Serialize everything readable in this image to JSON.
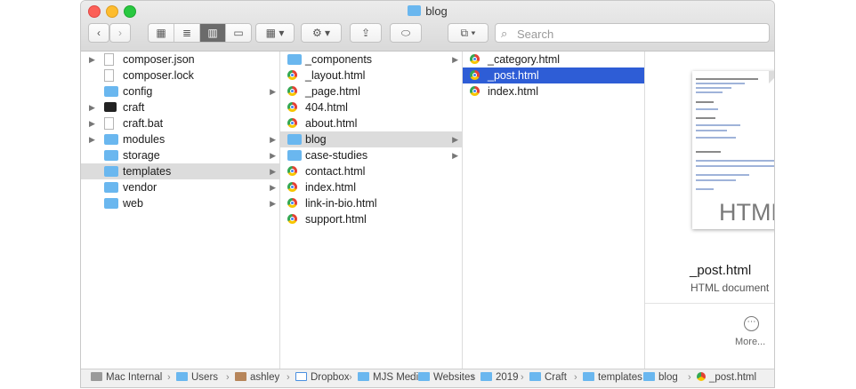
{
  "window": {
    "title": "blog"
  },
  "toolbar": {
    "back": "‹",
    "forward": "›",
    "view_icons": "▦",
    "view_list": "≣",
    "view_columns": "▥",
    "view_gallery": "▭",
    "group": "▦ ▾",
    "action": "⚙ ▾",
    "share": "⇪",
    "tag": "⬭",
    "dropbox": "⧉ ▾",
    "search_placeholder": "Search"
  },
  "columns": [
    {
      "items": [
        {
          "name": "composer.json",
          "kind": "doc",
          "disclosure": "▶"
        },
        {
          "name": "composer.lock",
          "kind": "doc",
          "disclosure": ""
        },
        {
          "name": "config",
          "kind": "folder",
          "arrow": "▶"
        },
        {
          "name": "craft",
          "kind": "exec",
          "disclosure": "▶"
        },
        {
          "name": "craft.bat",
          "kind": "doc",
          "disclosure": "▶"
        },
        {
          "name": "modules",
          "kind": "folder",
          "arrow": "▶",
          "disclosure": "▶"
        },
        {
          "name": "storage",
          "kind": "folder",
          "arrow": "▶"
        },
        {
          "name": "templates",
          "kind": "folder",
          "arrow": "▶",
          "state": "hl"
        },
        {
          "name": "vendor",
          "kind": "folder",
          "arrow": "▶"
        },
        {
          "name": "web",
          "kind": "folder",
          "arrow": "▶"
        }
      ]
    },
    {
      "items": [
        {
          "name": "_components",
          "kind": "folder",
          "arrow": "▶"
        },
        {
          "name": "_layout.html",
          "kind": "chrome"
        },
        {
          "name": "_page.html",
          "kind": "chrome"
        },
        {
          "name": "404.html",
          "kind": "chrome"
        },
        {
          "name": "about.html",
          "kind": "chrome"
        },
        {
          "name": "blog",
          "kind": "folder",
          "arrow": "▶",
          "state": "hl"
        },
        {
          "name": "case-studies",
          "kind": "folder",
          "arrow": "▶"
        },
        {
          "name": "contact.html",
          "kind": "chrome"
        },
        {
          "name": "index.html",
          "kind": "chrome"
        },
        {
          "name": "link-in-bio.html",
          "kind": "chrome"
        },
        {
          "name": "support.html",
          "kind": "chrome"
        }
      ]
    },
    {
      "items": [
        {
          "name": "_category.html",
          "kind": "chrome"
        },
        {
          "name": "_post.html",
          "kind": "chrome",
          "state": "sel"
        },
        {
          "name": "index.html",
          "kind": "chrome"
        }
      ]
    }
  ],
  "preview": {
    "thumb_label": "HTML",
    "name": "_post.html",
    "kind": "HTML document",
    "more_icon": "⋯",
    "more_label": "More..."
  },
  "pathbar": [
    {
      "label": "Mac Internal",
      "icon": "hd"
    },
    {
      "label": "Users",
      "icon": "fd"
    },
    {
      "label": "ashley",
      "icon": "hm"
    },
    {
      "label": "Dropbox",
      "icon": "db"
    },
    {
      "label": "MJS Media",
      "icon": "fd"
    },
    {
      "label": "Websites",
      "icon": "fd"
    },
    {
      "label": "2019",
      "icon": "fd"
    },
    {
      "label": "Craft",
      "icon": "fd"
    },
    {
      "label": "templates",
      "icon": "fd"
    },
    {
      "label": "blog",
      "icon": "fd"
    },
    {
      "label": "_post.html",
      "icon": "ch"
    }
  ],
  "pathbar_separator": "›"
}
